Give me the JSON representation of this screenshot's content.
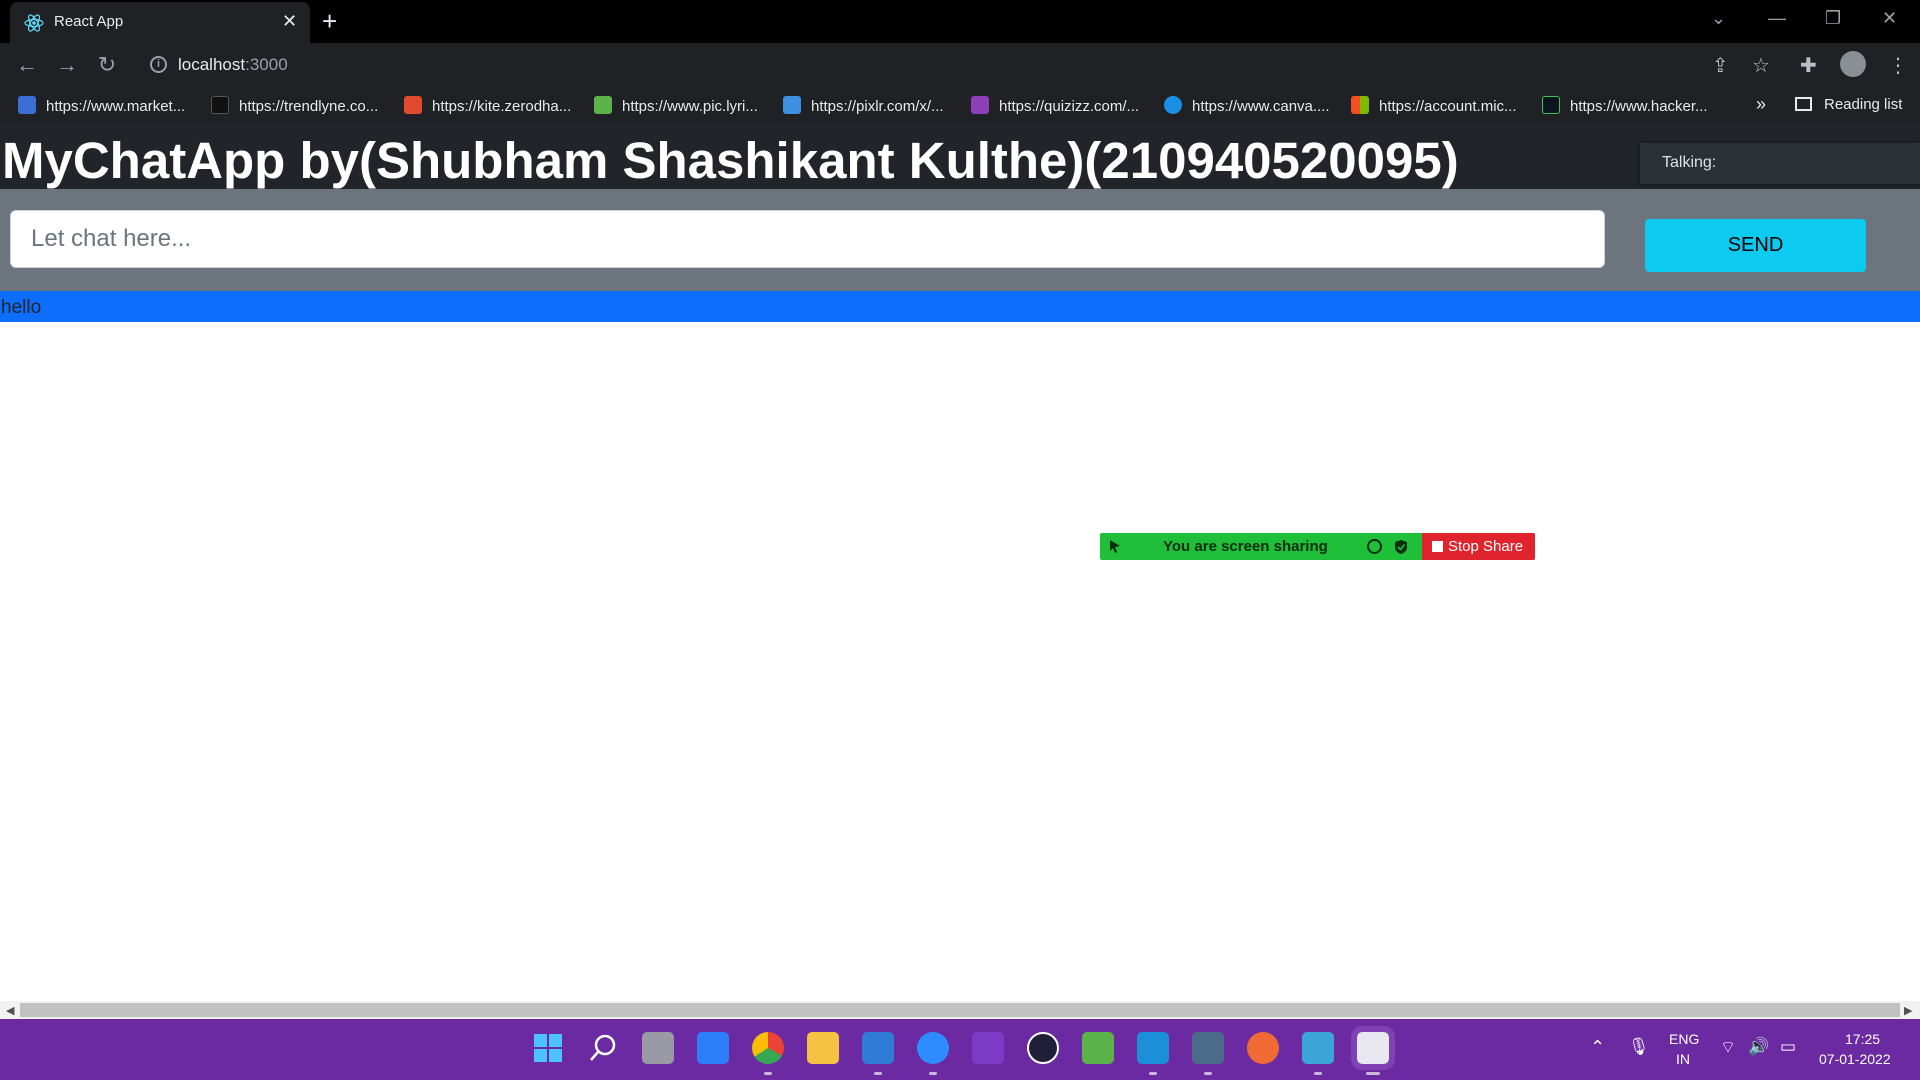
{
  "browser": {
    "tab_title": "React App",
    "tab_close": "✕",
    "new_tab": "+",
    "url_host": "localhost",
    "url_port": ":3000",
    "bookmarks": [
      {
        "label": "https://www.market...",
        "color": "#3b6fd6"
      },
      {
        "label": "https://trendlyne.co...",
        "color": "#111111"
      },
      {
        "label": "https://kite.zerodha...",
        "color": "#e04a2f"
      },
      {
        "label": "https://www.pic.lyri...",
        "color": "#5bb34a"
      },
      {
        "label": "https://pixlr.com/x/...",
        "color": "#3d8fe0"
      },
      {
        "label": "https://quizizz.com/...",
        "color": "#8c3fb7"
      },
      {
        "label": "https://www.canva....",
        "color": "#1a8fe3"
      },
      {
        "label": "https://account.mic...",
        "color": "#f25022"
      },
      {
        "label": "https://www.hacker...",
        "color": "#0e141e"
      }
    ],
    "bookmarks_more": "»",
    "reading_list": "Reading list"
  },
  "app": {
    "title": "MyChatApp by(Shubham Shashikant Kulthe)(210940520095)",
    "talking_label": "Talking:",
    "input_placeholder": "Let chat here...",
    "input_value": "",
    "send_label": "SEND",
    "messages": [
      "hello"
    ]
  },
  "share_banner": {
    "text": "You are screen sharing",
    "stop_label": "Stop Share"
  },
  "taskbar": {
    "lang_top": "ENG",
    "lang_bottom": "IN",
    "time": "17:25",
    "date": "07-01-2022"
  },
  "colors": {
    "appbar": "#212529",
    "inputbar": "#6c757d",
    "send_button": "#0dcaf0",
    "message_bg": "#0d6efd",
    "share_green": "#1fbf3a",
    "stop_red": "#e0242e",
    "taskbar": "#6b2aa2"
  }
}
